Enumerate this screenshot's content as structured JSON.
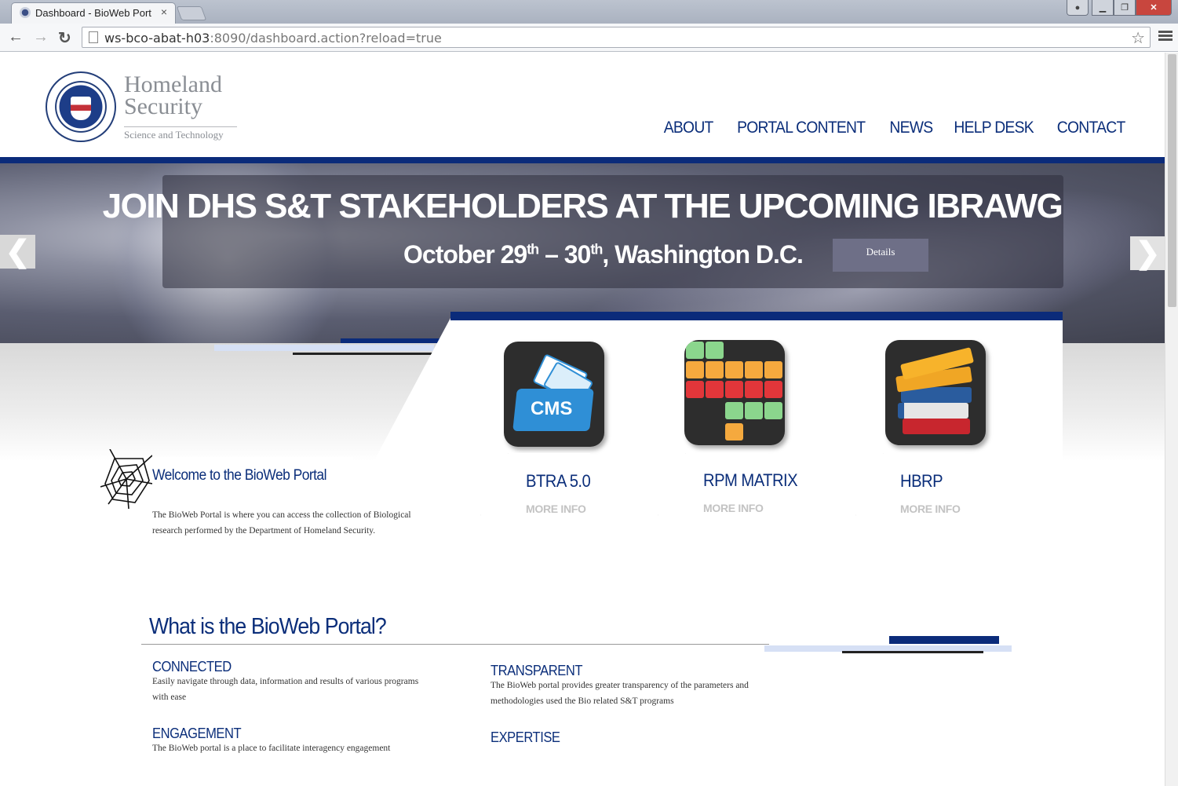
{
  "browser": {
    "tab_title": "Dashboard - BioWeb Port",
    "tab_close": "×",
    "url_host": "ws-bco-abat-h03",
    "url_rest": ":8090/dashboard.action?reload=true",
    "back": "←",
    "forward": "→",
    "reload": "↻",
    "star": "☆",
    "min": "▁",
    "max": "❐",
    "close": "✕",
    "user": "●"
  },
  "brand": {
    "line1": "Homeland",
    "line2": "Security",
    "line3": "Science and Technology"
  },
  "nav": [
    "ABOUT",
    "PORTAL CONTENT",
    "NEWS",
    "HELP DESK",
    "CONTACT"
  ],
  "hero": {
    "title": "JOIN DHS S&T STAKEHOLDERS AT THE UPCOMING IBRAWG",
    "date_a": "October 29",
    "sup_a": "th",
    "date_sep": " – 30",
    "sup_b": "th",
    "date_b": ", Washington D.C.",
    "details": "Details",
    "prev": "❮",
    "next": "❯"
  },
  "apps": [
    {
      "label": "BTRA 5.0",
      "more": "MORE INFO",
      "icon": "cms-icon",
      "icon_text": "CMS"
    },
    {
      "label": "RPM MATRIX",
      "more": "MORE INFO",
      "icon": "grid-icon"
    },
    {
      "label": "HBRP",
      "more": "MORE INFO",
      "icon": "books-icon"
    }
  ],
  "welcome": {
    "title": "Welcome to the BioWeb Portal",
    "text": "The BioWeb Portal is where you can access the collection of Biological research performed by the Department of Homeland Security."
  },
  "what": {
    "title": "What is the BioWeb Portal?",
    "features": [
      {
        "heading": "CONNECTED",
        "text": "Easily navigate through data, information and results of various programs with ease"
      },
      {
        "heading": "TRANSPARENT",
        "text": "The BioWeb portal provides greater transparency of the parameters and methodologies used the Bio related S&T programs"
      },
      {
        "heading": "ENGAGEMENT",
        "text": "The BioWeb portal is a place to facilitate interagency engagement"
      },
      {
        "heading": "EXPERTISE",
        "text": ""
      }
    ]
  },
  "colors": {
    "navy": "#0b2b7a",
    "link": "#0b2e7a",
    "details_btn": "#6e6f87"
  }
}
